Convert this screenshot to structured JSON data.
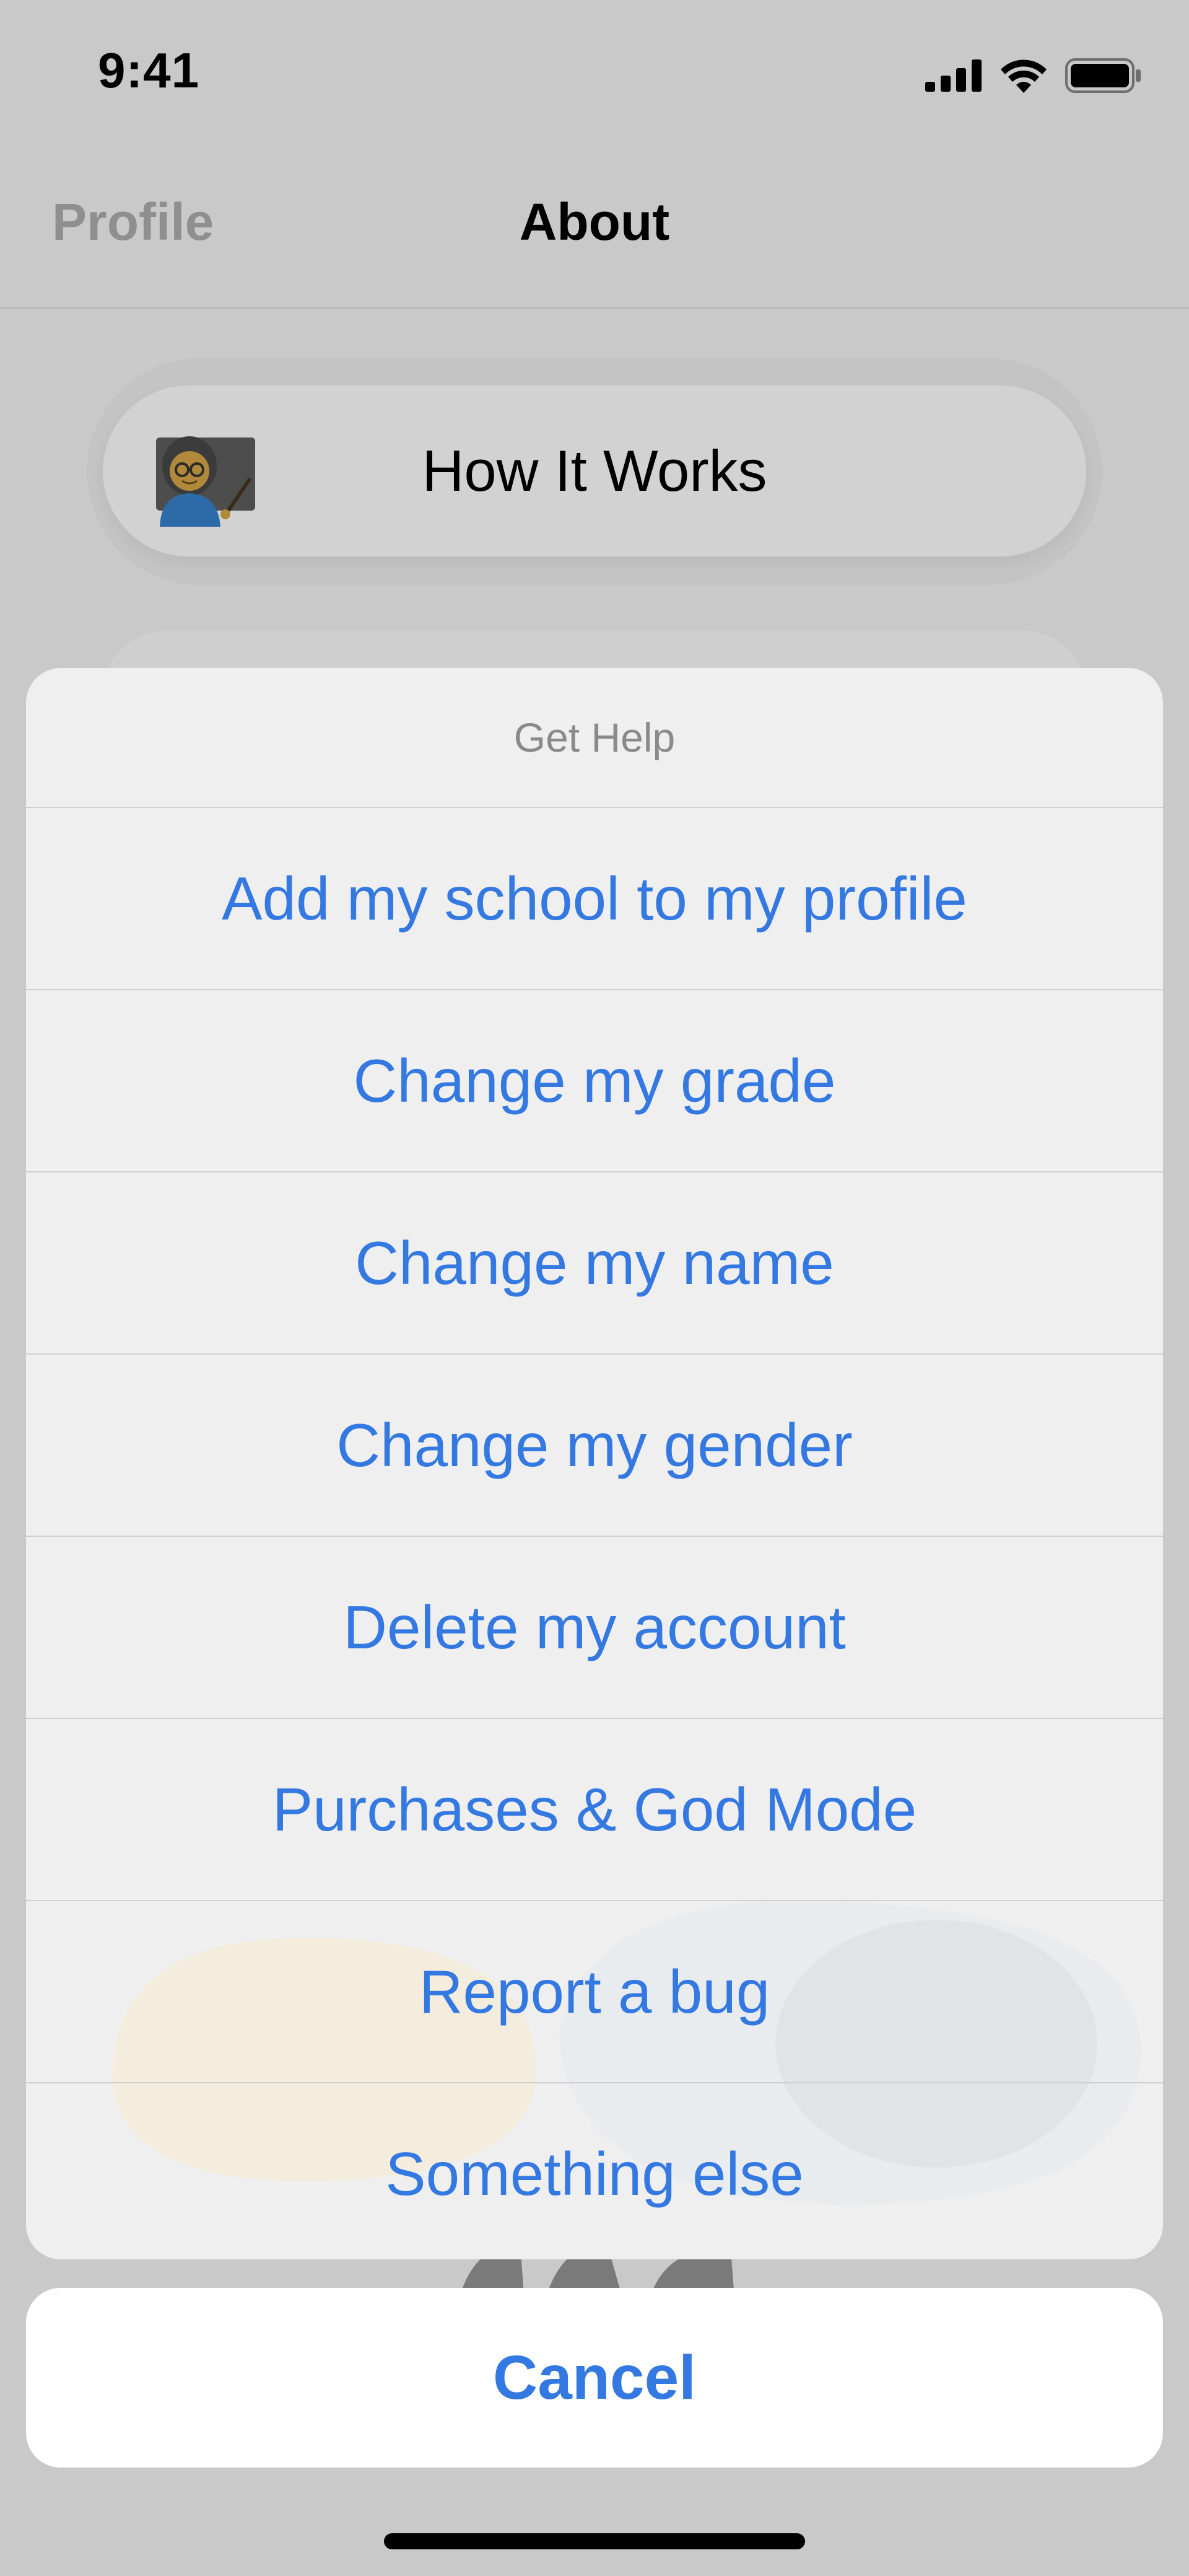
{
  "status_bar": {
    "time": "9:41",
    "icons": [
      "cellular-signal-icon",
      "wifi-icon",
      "battery-icon"
    ]
  },
  "nav": {
    "tabs": [
      {
        "label": "Profile",
        "active": false
      },
      {
        "label": "About",
        "active": true
      }
    ]
  },
  "cards": {
    "how_it_works": {
      "label": "How It Works",
      "icon": "teacher-emoji-icon"
    }
  },
  "action_sheet": {
    "title": "Get Help",
    "options": [
      "Add my school to my profile",
      "Change my grade",
      "Change my name",
      "Change my gender",
      "Delete my account",
      "Purchases & God Mode",
      "Report a bug",
      "Something else"
    ],
    "cancel_label": "Cancel"
  },
  "colors": {
    "accent": "#3478e2",
    "dim_background": "#c9c9c9",
    "sheet_background": "#efefef",
    "secondary_text": "#8a8a8a"
  }
}
